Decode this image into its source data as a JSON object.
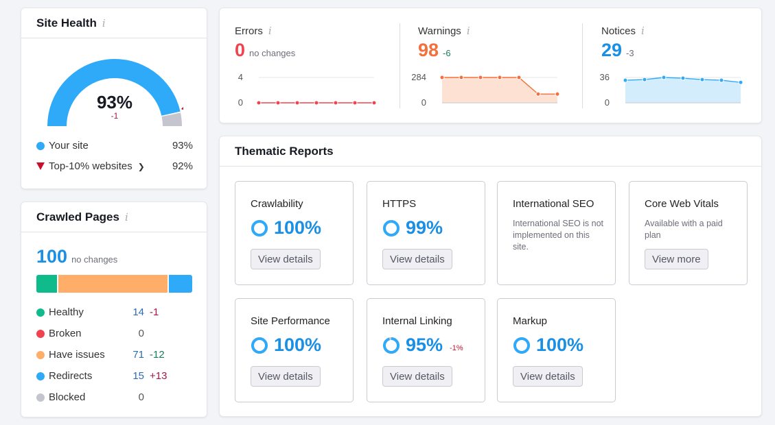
{
  "site_health": {
    "title": "Site Health",
    "info_icon": "info-icon",
    "score": "93%",
    "score_value": 93,
    "delta": "-1",
    "legend": [
      {
        "label": "Your site",
        "value": "93%",
        "color": "#2eaaf9"
      },
      {
        "label": "Top-10% websites",
        "value": "92%",
        "color": "#c8102e"
      }
    ],
    "top10_value": 92,
    "colors": {
      "fill": "#2eaaf9",
      "rest": "#c4c5cf",
      "marker": "#c8102e"
    }
  },
  "crawled_pages": {
    "title": "Crawled Pages",
    "total": "100",
    "total_delta": "no changes",
    "rows": [
      {
        "label": "Healthy",
        "count": "14",
        "delta": "-1",
        "count_value": 14,
        "color": "#0fbb8a",
        "delta_color": "#a3174a"
      },
      {
        "label": "Broken",
        "count": "0",
        "delta": "",
        "count_value": 0,
        "color": "#f1434f",
        "delta_color": ""
      },
      {
        "label": "Have issues",
        "count": "71",
        "delta": "-12",
        "count_value": 71,
        "color": "#ffae6a",
        "delta_color": "#1a7a5c"
      },
      {
        "label": "Redirects",
        "count": "15",
        "delta": "+13",
        "count_value": 15,
        "color": "#2eaaf9",
        "delta_color": "#a3174a"
      },
      {
        "label": "Blocked",
        "count": "0",
        "delta": "",
        "count_value": 0,
        "color": "#c4c5cf",
        "delta_color": ""
      }
    ]
  },
  "issues": {
    "errors": {
      "title": "Errors",
      "count": "0",
      "delta": "no changes",
      "color": "#f1434f",
      "delta_color": "#6c6e79",
      "y_max_label": "4",
      "y_min_label": "0",
      "y_max": 4,
      "points": [
        0,
        0,
        0,
        0,
        0,
        0,
        0
      ],
      "fill": false
    },
    "warnings": {
      "title": "Warnings",
      "count": "98",
      "delta": "-6",
      "color": "#f36f3b",
      "delta_color": "#1a7a5c",
      "y_max_label": "284",
      "y_min_label": "0",
      "y_max": 284,
      "points": [
        284,
        284,
        284,
        284,
        284,
        98,
        98
      ],
      "fill": true,
      "fill_color": "#fde1d2"
    },
    "notices": {
      "title": "Notices",
      "count": "29",
      "delta": "-3",
      "color": "#1a8fe6",
      "delta_color": "#6c6e79",
      "line_color": "#2eaaf9",
      "y_max_label": "36",
      "y_min_label": "0",
      "y_max": 36,
      "points": [
        32,
        33,
        36,
        35,
        33,
        32,
        29
      ],
      "fill": true,
      "fill_color": "#d3edfd"
    }
  },
  "thematic": {
    "title": "Thematic Reports",
    "cards": [
      {
        "title": "Crawlability",
        "pct": "100%",
        "value": 100,
        "delta": "",
        "button": "View details"
      },
      {
        "title": "HTTPS",
        "pct": "99%",
        "value": 99,
        "delta": "",
        "button": "View details"
      },
      {
        "title": "International SEO",
        "description": "International SEO is not implemented on this site.",
        "button": ""
      },
      {
        "title": "Core Web Vitals",
        "description": "Available with a paid plan",
        "button": "View more"
      },
      {
        "title": "Site Performance",
        "pct": "100%",
        "value": 100,
        "delta": "",
        "button": "View details"
      },
      {
        "title": "Internal Linking",
        "pct": "95%",
        "value": 95,
        "delta": "-1%",
        "button": "View details"
      },
      {
        "title": "Markup",
        "pct": "100%",
        "value": 100,
        "delta": "",
        "button": "View details"
      }
    ],
    "ring_color": "#2eaaf9",
    "ring_rest_color": "#c4c5cf"
  }
}
